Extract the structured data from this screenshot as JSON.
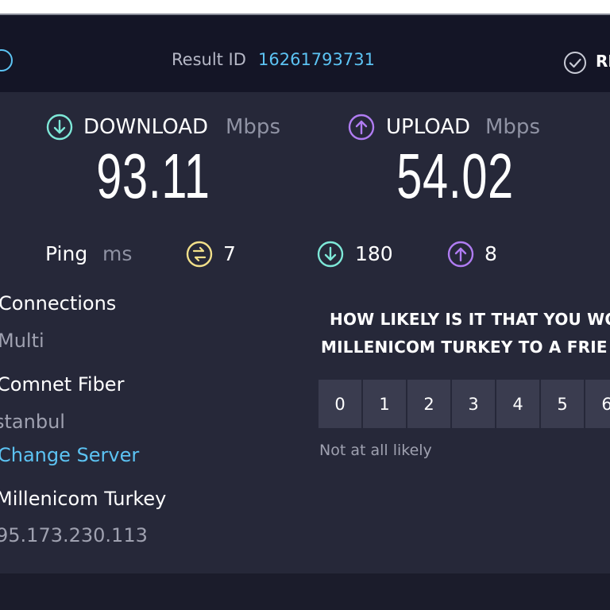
{
  "header": {
    "result_label": "Result ID",
    "result_id": "16261793731",
    "results_label": "RE"
  },
  "download": {
    "title": "DOWNLOAD",
    "unit": "Mbps",
    "value": "93.11",
    "icon": "download-arrow-icon"
  },
  "upload": {
    "title": "UPLOAD",
    "unit": "Mbps",
    "value": "54.02",
    "icon": "upload-arrow-icon"
  },
  "ping": {
    "label": "Ping",
    "unit": "ms",
    "idle": "7",
    "download": "180",
    "upload": "8"
  },
  "info": {
    "connections_label": "Connections",
    "connections_value": "Multi",
    "host_label": "Comnet Fiber",
    "host_location": "stanbul",
    "change_server": "Change Server",
    "isp_label": "Millenicom Turkey",
    "isp_ip": "95.173.230.113"
  },
  "survey": {
    "question_line1": "HOW LIKELY IS IT THAT YOU WO",
    "question_line2": "MILLENICOM TURKEY TO A FRIE",
    "scale": [
      "0",
      "1",
      "2",
      "3",
      "4",
      "5",
      "6"
    ],
    "low_label": "Not at all likely"
  },
  "colors": {
    "accent_blue": "#5cc3f3",
    "download_cyan": "#7ee8d8",
    "upload_purple": "#b07cf2",
    "ping_yellow": "#f2e08a",
    "background": "#262839"
  }
}
